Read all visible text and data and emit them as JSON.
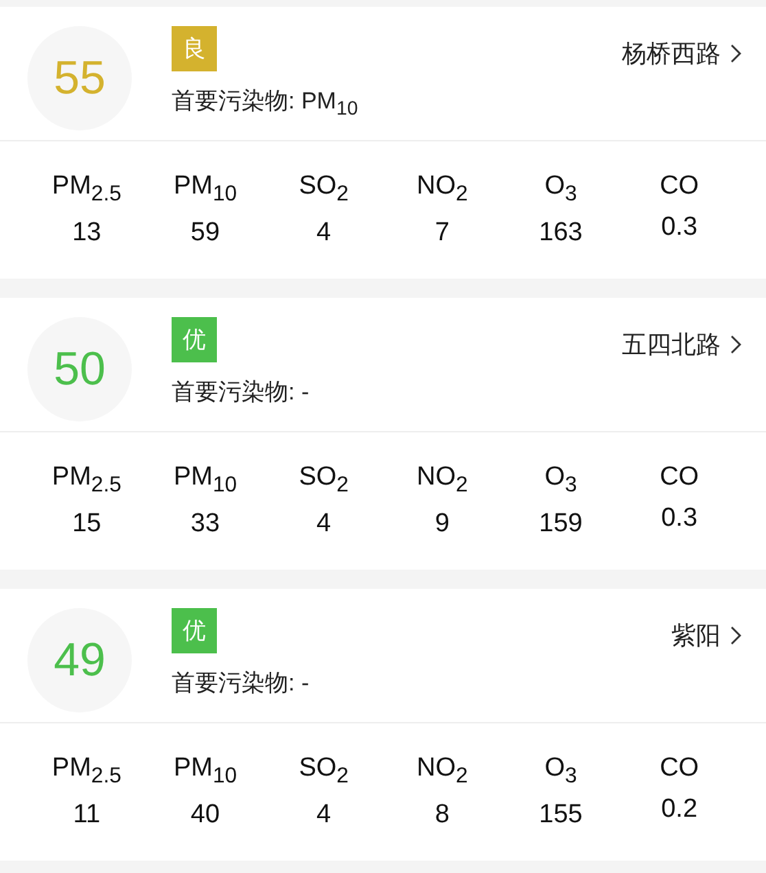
{
  "stations": [
    {
      "aqi": "55",
      "color": "#d4b22e",
      "grade": "良",
      "location": "杨桥西路",
      "primary": "首要污染物: PM$_{10}$",
      "pollutants": [
        {
          "name": "PM$_{2.5}$",
          "value": "13"
        },
        {
          "name": "PM$_{10}$",
          "value": "59"
        },
        {
          "name": "SO$_{2}$",
          "value": "4"
        },
        {
          "name": "NO$_{2}$",
          "value": "7"
        },
        {
          "name": "O$_{3}$",
          "value": "163"
        },
        {
          "name": "CO",
          "value": "0.3"
        }
      ]
    },
    {
      "aqi": "50",
      "color": "#4cbf4c",
      "grade": "优",
      "location": "五四北路",
      "primary": "首要污染物: -",
      "pollutants": [
        {
          "name": "PM$_{2.5}$",
          "value": "15"
        },
        {
          "name": "PM$_{10}$",
          "value": "33"
        },
        {
          "name": "SO$_{2}$",
          "value": "4"
        },
        {
          "name": "NO$_{2}$",
          "value": "9"
        },
        {
          "name": "O$_{3}$",
          "value": "159"
        },
        {
          "name": "CO",
          "value": "0.3"
        }
      ]
    },
    {
      "aqi": "49",
      "color": "#4cbf4c",
      "grade": "优",
      "location": "紫阳",
      "primary": "首要污染物: -",
      "pollutants": [
        {
          "name": "PM$_{2.5}$",
          "value": "11"
        },
        {
          "name": "PM$_{10}$",
          "value": "40"
        },
        {
          "name": "SO$_{2}$",
          "value": "4"
        },
        {
          "name": "NO$_{2}$",
          "value": "8"
        },
        {
          "name": "O$_{3}$",
          "value": "155"
        },
        {
          "name": "CO",
          "value": "0.2"
        }
      ]
    }
  ]
}
